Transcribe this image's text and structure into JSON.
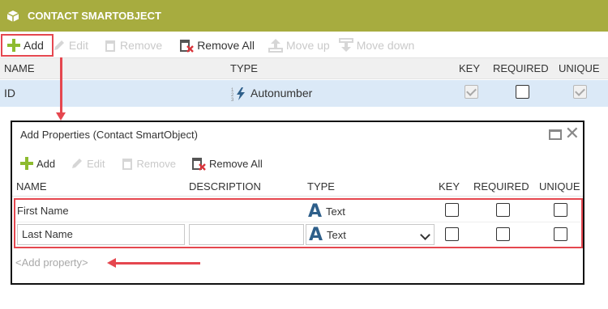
{
  "title": "CONTACT SMARTOBJECT",
  "toolbar": {
    "add": "Add",
    "edit": "Edit",
    "remove": "Remove",
    "remove_all": "Remove All",
    "move_up": "Move up",
    "move_down": "Move down"
  },
  "columns": {
    "name": "NAME",
    "type": "TYPE",
    "key": "KEY",
    "required": "REQUIRED",
    "unique": "UNIQUE"
  },
  "id_row": {
    "name": "ID",
    "type": "Autonumber",
    "key": true,
    "required": false,
    "unique": true
  },
  "dialog": {
    "title": "Add Properties (Contact SmartObject)",
    "toolbar": {
      "add": "Add",
      "edit": "Edit",
      "remove": "Remove",
      "remove_all": "Remove All"
    },
    "columns": {
      "name": "NAME",
      "description": "DESCRIPTION",
      "type": "TYPE",
      "key": "KEY",
      "required": "REQUIRED",
      "unique": "UNIQUE"
    },
    "rows": [
      {
        "name": "First Name",
        "description": "",
        "type": "Text",
        "key": false,
        "required": false,
        "unique": false
      },
      {
        "name": "Last Name",
        "description": "",
        "type": "Text",
        "key": false,
        "required": false,
        "unique": false
      }
    ],
    "add_property_placeholder": "<Add property>"
  },
  "colors": {
    "header_bg": "#a7ac3f",
    "highlight": "#e5474f",
    "selected_row": "#dbe9f7",
    "add_icon": "#8dbb2f",
    "type_icon": "#2e5f8a"
  },
  "icons": {
    "title": "cube-icon",
    "add": "plus-icon",
    "edit": "pencil-icon",
    "remove": "trash-icon",
    "remove_all": "trash-x-icon",
    "move_up": "move-up-icon",
    "move_down": "move-down-icon",
    "autonumber": "autonumber-icon",
    "text": "text-type-icon"
  }
}
